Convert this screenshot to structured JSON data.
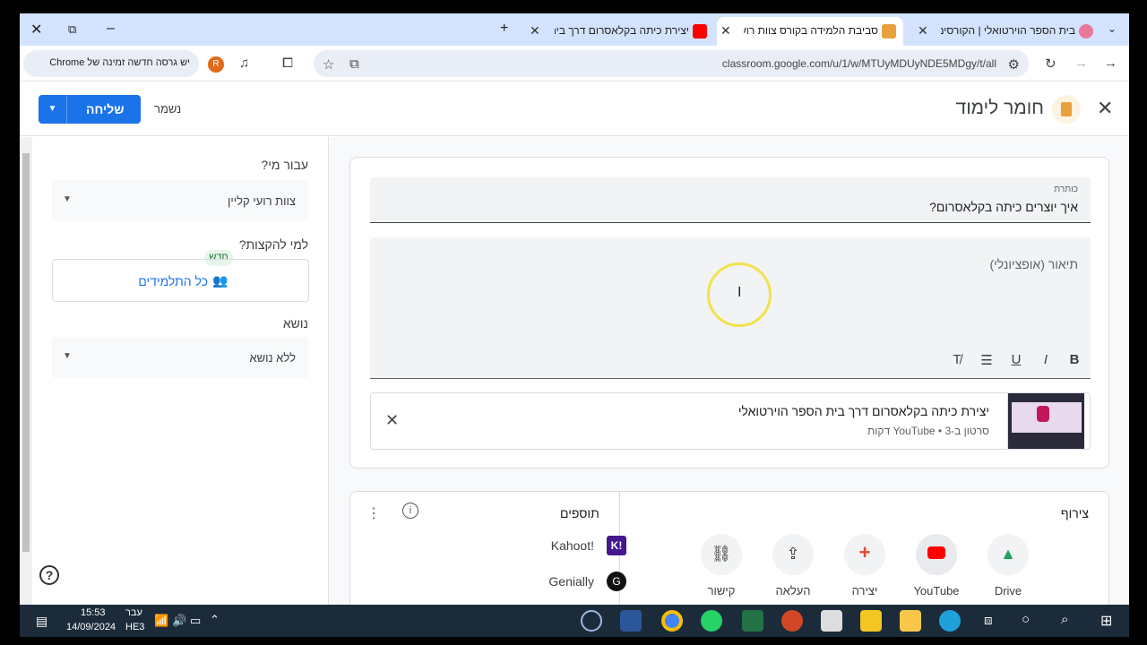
{
  "browser": {
    "tabs": [
      {
        "title": "בית הספר הוירטואלי | הקורסים",
        "favicon_color": "#e8789a",
        "active": false
      },
      {
        "title": "סביבת הלמידה בקורס צוות רועי",
        "favicon_color": "#e8a13d",
        "active": true
      },
      {
        "title": "יצירת כיתה בקלאסרום דרך בית",
        "favicon_color": "#ff0000",
        "active": false
      }
    ],
    "new_tab_symbol": "+",
    "url": "classroom.google.com/u/1/w/MTUyMDUyNDE5MDgy/t/all",
    "update_text": "יש גרסה חדשה זמינה של Chrome",
    "profile_initial": "R"
  },
  "header": {
    "title": "חומר לימוד",
    "send_label": "שליחה",
    "saved_label": "נשמר"
  },
  "left": {
    "for_whom_label": "עבור מי?",
    "class_value": "צוות רועי קליין",
    "assign_label": "למי להקצות?",
    "new_chip": "חדש",
    "all_students": "כל התלמידים",
    "topic_label": "נושא",
    "topic_value": "ללא נושא"
  },
  "main": {
    "title_field_label": "כותרת",
    "title_value": "איך יוצרים כיתה בקלאסרום?",
    "description_placeholder": "תיאור (אופציונלי)",
    "attachment": {
      "title": "יצירת כיתה בקלאסרום דרך בית הספר הוירטואלי",
      "meta": "סרטון ב-YouTube • 3 דקות"
    },
    "attach_section_label": "צירוף",
    "attach_buttons": [
      {
        "label": "Drive",
        "icon": "drive-icon"
      },
      {
        "label": "YouTube",
        "icon": "youtube-icon"
      },
      {
        "label": "יצירה",
        "icon": "plus-icon"
      },
      {
        "label": "העלאה",
        "icon": "upload-icon"
      },
      {
        "label": "קישור",
        "icon": "link-icon"
      }
    ],
    "addons_label": "תוספים",
    "addons": [
      {
        "name": "Kahoot!",
        "color": "#46178f"
      },
      {
        "name": "Genially",
        "color": "#111111"
      }
    ]
  },
  "taskbar": {
    "time": "15:53",
    "date": "14/09/2024",
    "lang_top": "עבר",
    "lang_bottom": "HE3"
  }
}
